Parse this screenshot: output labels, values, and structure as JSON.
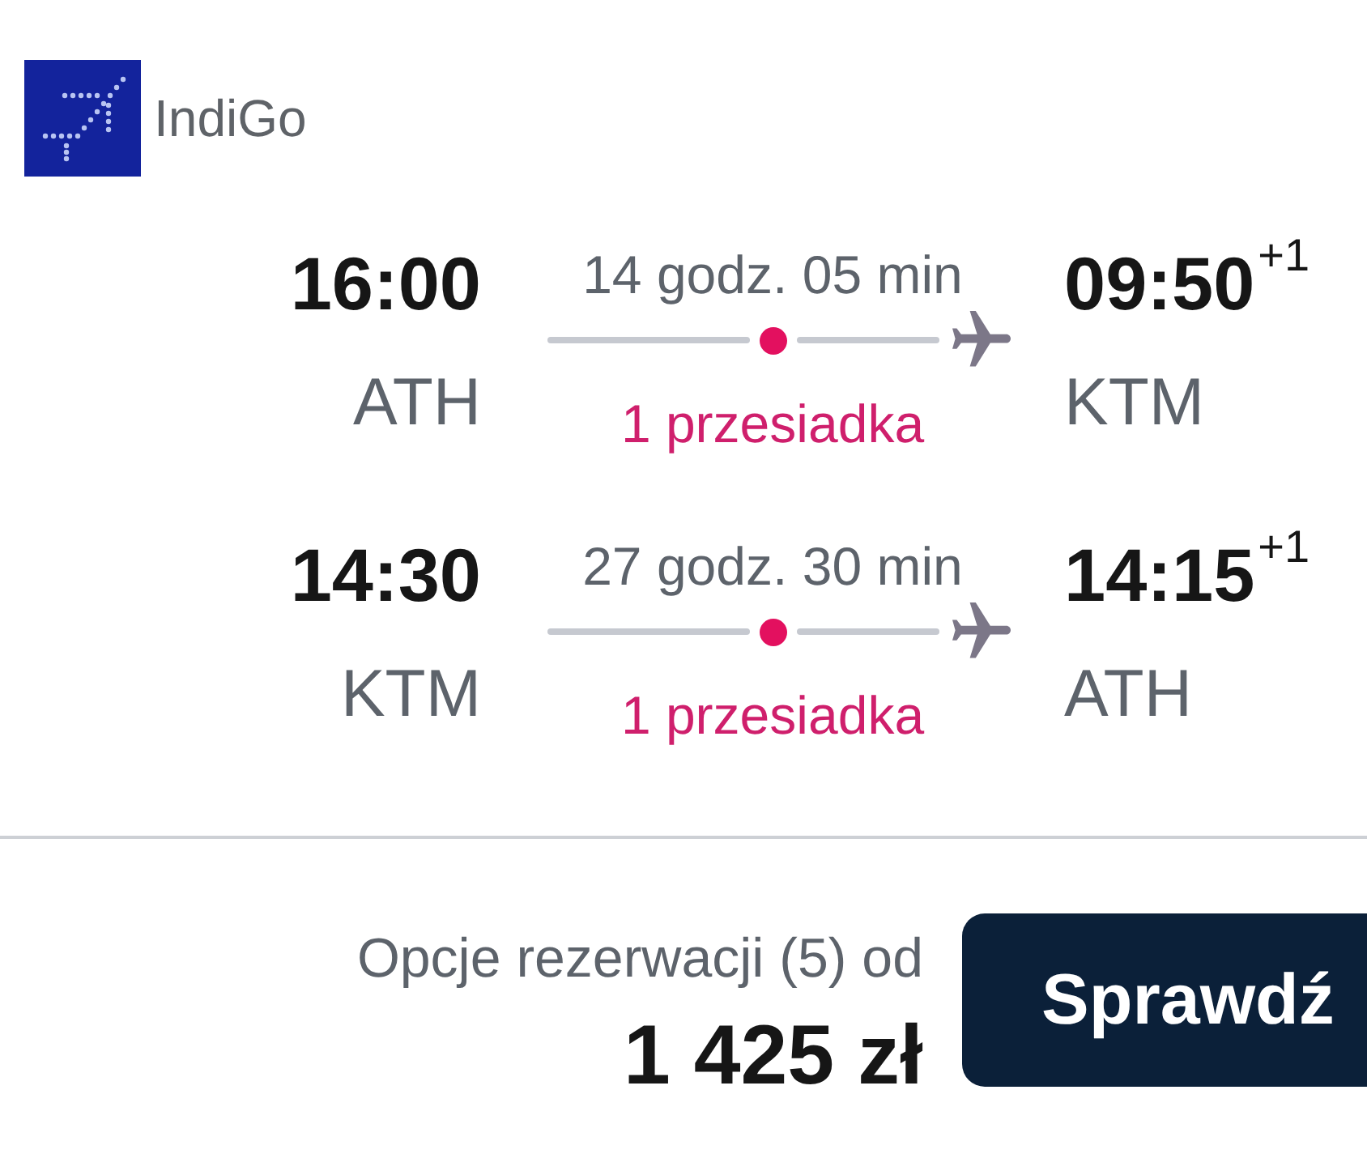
{
  "airline": {
    "name": "IndiGo"
  },
  "flights": [
    {
      "departure_time": "16:00",
      "departure_airport": "ATH",
      "duration": "14 godz. 05 min",
      "stops": "1 przesiadka",
      "arrival_time": "09:50",
      "arrival_day_offset": "+1",
      "arrival_airport": "KTM"
    },
    {
      "departure_time": "14:30",
      "departure_airport": "KTM",
      "duration": "27 godz. 30 min",
      "stops": "1 przesiadka",
      "arrival_time": "14:15",
      "arrival_day_offset": "+1",
      "arrival_airport": "ATH"
    }
  ],
  "booking": {
    "options_label": "Opcje rezerwacji (5) od",
    "price": "1 425 zł",
    "button": "Sprawdź"
  }
}
